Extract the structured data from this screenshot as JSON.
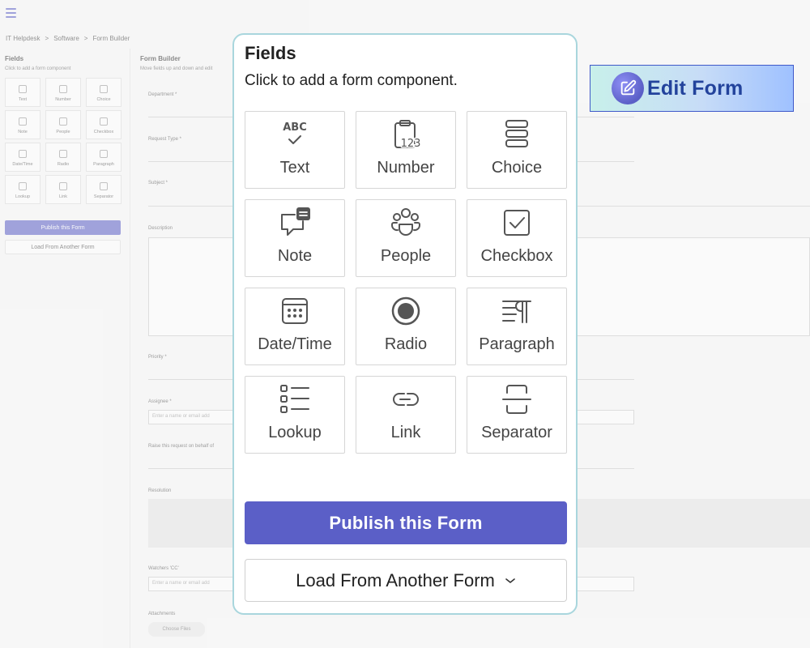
{
  "background": {
    "breadcrumbs": [
      "IT Helpdesk",
      ">",
      "Software",
      ">",
      "Form Builder"
    ],
    "sidebar": {
      "title": "Fields",
      "subtitle": "Click to add a form component",
      "tiles": [
        "Text",
        "Number",
        "Choice",
        "Note",
        "People",
        "Checkbox",
        "Date/Time",
        "Radio",
        "Paragraph",
        "Lookup",
        "Link",
        "Separator"
      ],
      "publish_label": "Publish this Form",
      "load_label": "Load From Another Form"
    },
    "form_builder": {
      "title": "Form Builder",
      "subtitle": "Move fields up and down and edit",
      "fields": [
        "Department *",
        "Request Type *",
        "Subject *",
        "Description",
        "Priority *",
        "Assignee *",
        "Raise this request on behalf of",
        "Resolution",
        "Watchers 'CC'",
        "Attachments"
      ],
      "assignee_placeholder": "Enter a name or email add",
      "watchers_placeholder": "Enter a name or email add",
      "choose_files_label": "Choose Files"
    }
  },
  "edit_badge": {
    "label": "Edit Form",
    "icon": "edit-icon"
  },
  "panel": {
    "title": "Fields",
    "subtitle": "Click to add a form component.",
    "tiles": [
      {
        "label": "Text",
        "icon": "text-abc-icon"
      },
      {
        "label": "Number",
        "icon": "number-clipboard-icon"
      },
      {
        "label": "Choice",
        "icon": "choice-list-icon"
      },
      {
        "label": "Note",
        "icon": "note-icon"
      },
      {
        "label": "People",
        "icon": "people-icon"
      },
      {
        "label": "Checkbox",
        "icon": "checkbox-icon"
      },
      {
        "label": "Date/Time",
        "icon": "calendar-icon"
      },
      {
        "label": "Radio",
        "icon": "radio-icon"
      },
      {
        "label": "Paragraph",
        "icon": "paragraph-icon"
      },
      {
        "label": "Lookup",
        "icon": "lookup-list-icon"
      },
      {
        "label": "Link",
        "icon": "link-icon"
      },
      {
        "label": "Separator",
        "icon": "separator-icon"
      }
    ],
    "publish_label": "Publish this Form",
    "load_label": "Load From Another Form"
  },
  "colors": {
    "accent": "#5b5fc7",
    "panel_border": "#a9d6dd",
    "badge_text": "#23439c"
  }
}
